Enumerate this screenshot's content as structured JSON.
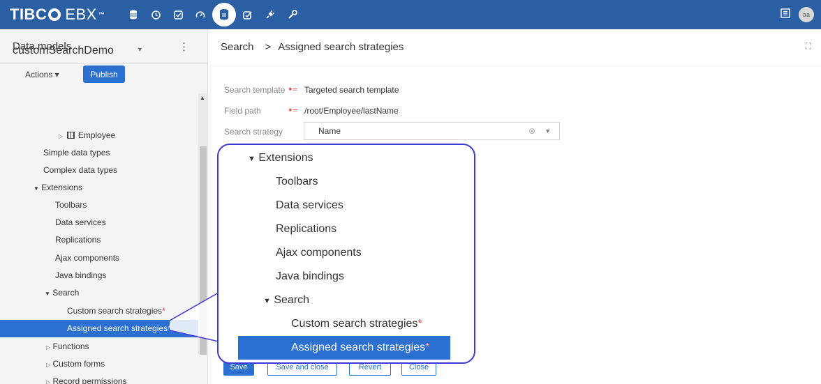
{
  "app": {
    "logo_text": "TIBC",
    "logo_suffix": "EBX",
    "logo_tm": "™",
    "avatar_initials": "aa"
  },
  "nav_icons": [
    "database-icon",
    "clock-icon",
    "check-square-icon",
    "gauge-icon",
    "data-model-icon",
    "task-icon",
    "plug-icon",
    "wrench-icon"
  ],
  "left_panel": {
    "title": "Data models",
    "model_name": "customSearchDemo",
    "actions_label": "Actions ▾",
    "publish_label": "Publish",
    "tree": {
      "employee": "Employee",
      "simple_types": "Simple data types",
      "complex_types": "Complex data types",
      "extensions": "Extensions",
      "toolbars": "Toolbars",
      "data_services": "Data services",
      "replications": "Replications",
      "ajax_components": "Ajax components",
      "java_bindings": "Java bindings",
      "search": "Search",
      "custom_search": "Custom search strategies",
      "assigned_search": "Assigned search strategies",
      "functions": "Functions",
      "custom_forms": "Custom forms",
      "record_permissions": "Record permissions"
    }
  },
  "breadcrumb": {
    "root": "Search",
    "separator": ">",
    "current": "Assigned search strategies"
  },
  "form": {
    "search_template_label": "Search template",
    "search_template_value": "Targeted search template",
    "field_path_label": "Field path",
    "field_path_value": "/root/Employee/lastName",
    "search_strategy_label": "Search strategy",
    "search_strategy_value": "Name"
  },
  "buttons": {
    "save": "Save",
    "save_close": "Save and close",
    "revert": "Revert",
    "close": "Close"
  },
  "zoom": {
    "extensions": "Extensions",
    "toolbars": "Toolbars",
    "data_services": "Data services",
    "replications": "Replications",
    "ajax_components": "Ajax components",
    "java_bindings": "Java bindings",
    "search": "Search",
    "custom_search": "Custom search strategies",
    "assigned_search": "Assigned search strategies"
  },
  "colors": {
    "topbar": "#2b5fa3",
    "accent": "#2b6fd1",
    "callout_border": "#3d3ad6",
    "required": "#d83b3b"
  }
}
